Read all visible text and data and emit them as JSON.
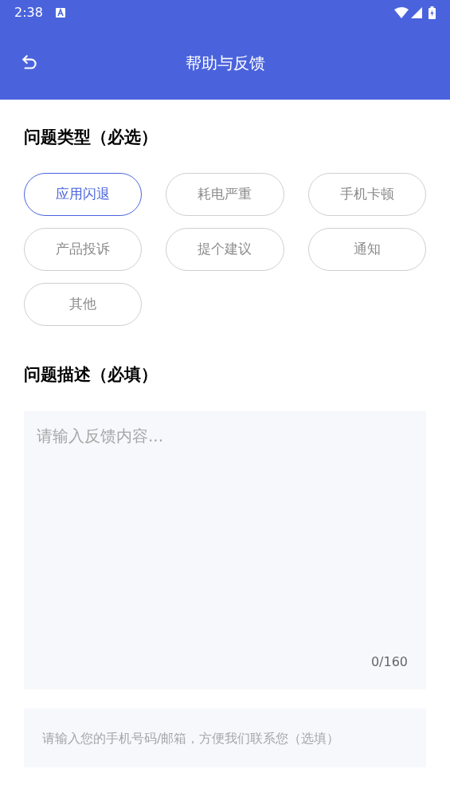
{
  "status_bar": {
    "time": "2:38"
  },
  "toolbar": {
    "title": "帮助与反馈"
  },
  "category_section": {
    "title": "问题类型（必选）",
    "options": [
      {
        "label": "应用闪退",
        "selected": true
      },
      {
        "label": "耗电严重",
        "selected": false
      },
      {
        "label": "手机卡顿",
        "selected": false
      },
      {
        "label": "产品投诉",
        "selected": false
      },
      {
        "label": "提个建议",
        "selected": false
      },
      {
        "label": "通知",
        "selected": false
      },
      {
        "label": "其他",
        "selected": false
      }
    ]
  },
  "description_section": {
    "title": "问题描述（必填）",
    "placeholder": "请输入反馈内容...",
    "counter": "0/160"
  },
  "contact_field": {
    "placeholder": "请输入您的手机号码/邮箱，方便我们联系您（选填）"
  }
}
